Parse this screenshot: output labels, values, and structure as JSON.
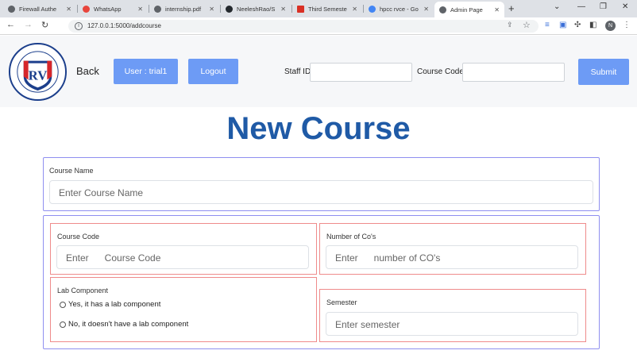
{
  "browser": {
    "tabs": [
      {
        "label": "Firewall Authe",
        "icon": "globe-icon",
        "color": "#5f6368"
      },
      {
        "label": "WhatsApp",
        "icon": "whatsapp-icon",
        "color": "#e8453c"
      },
      {
        "label": "internship.pdf",
        "icon": "globe-icon",
        "color": "#5f6368"
      },
      {
        "label": "NeeleshRao/S",
        "icon": "github-icon",
        "color": "#24292e"
      },
      {
        "label": "Third Semeste",
        "icon": "gmail-icon",
        "color": "#d93025"
      },
      {
        "label": "hpcc rvce - Go",
        "icon": "google-icon",
        "color": "#4285f4"
      },
      {
        "label": "Admin Page",
        "icon": "globe-icon",
        "color": "#5f6368"
      }
    ],
    "active_tab": 6,
    "url": "127.0.0.1:5000/addcourse",
    "profile_initial": "N"
  },
  "header": {
    "back_label": "Back",
    "user_label": "User : trial1",
    "logout_label": "Logout",
    "staff_id_label": "Staff ID",
    "course_code_label": "Course Code",
    "submit_label": "Submit",
    "accent_color": "#6d9bf5"
  },
  "logo": {
    "initials": "RV",
    "ring_text_top": "Rashtreeya Sikshana Samithi Trust",
    "ring_text_bottom": "INSTITUTIONS"
  },
  "form": {
    "title": "New Course",
    "course_name": {
      "label": "Course Name",
      "placeholder": "Enter Course Name"
    },
    "course_code": {
      "label": "Course Code",
      "placeholder": "Enter      Course Code"
    },
    "num_cos": {
      "label": "Number of Co's",
      "placeholder": "Enter      number of CO's"
    },
    "lab_component": {
      "label": "Lab Component",
      "options": [
        "Yes, it has a lab component",
        "No, it doesn't have a lab component"
      ]
    },
    "semester": {
      "label": "Semester",
      "placeholder": "Enter semester"
    }
  }
}
